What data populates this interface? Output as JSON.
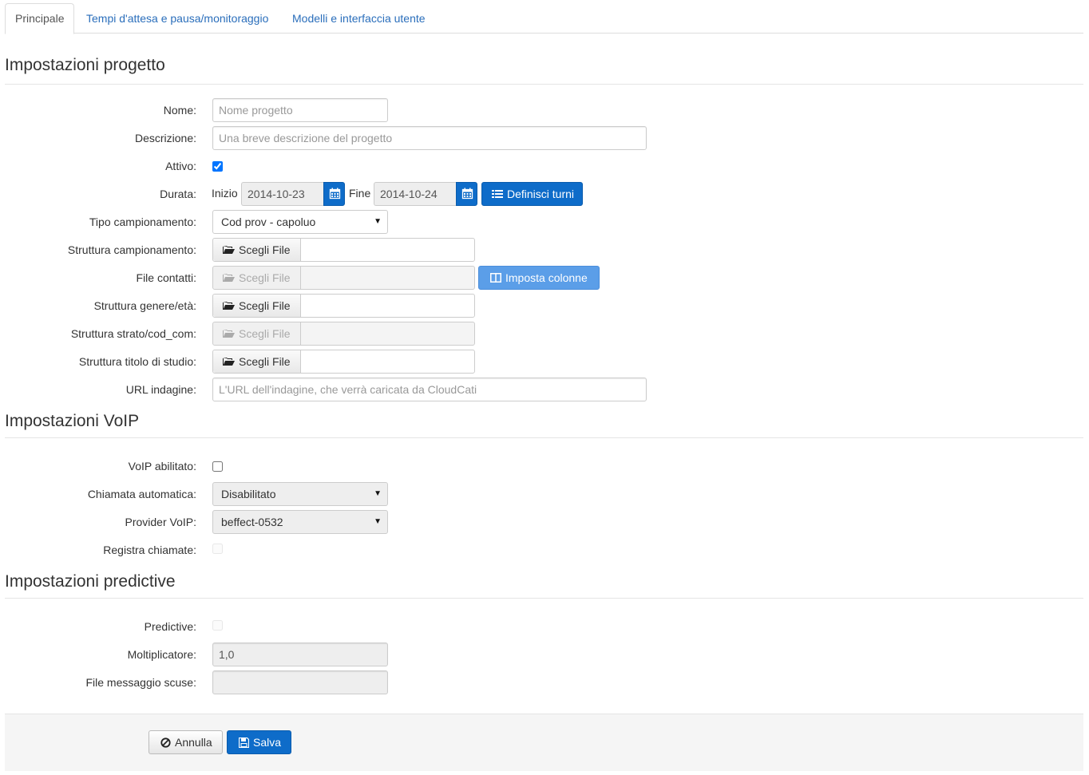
{
  "tabs": [
    {
      "label": "Principale"
    },
    {
      "label": "Tempi d'attesa e pausa/monitoraggio"
    },
    {
      "label": "Modelli e interfaccia utente"
    }
  ],
  "project": {
    "title": "Impostazioni progetto",
    "name_label": "Nome:",
    "name_placeholder": "Nome progetto",
    "desc_label": "Descrizione:",
    "desc_placeholder": "Una breve descrizione del progetto",
    "active_label": "Attivo:",
    "active_checked": true,
    "duration_label": "Durata:",
    "start_label": "Inizio",
    "start_value": "2014-10-23",
    "end_label": "Fine",
    "end_value": "2014-10-24",
    "shifts_button": "Definisci turni",
    "sampling_type_label": "Tipo campionamento:",
    "sampling_type_value": "Cod prov - capoluo",
    "sampling_structure_label": "Struttura campionamento:",
    "contacts_file_label": "File contatti:",
    "columns_button": "Imposta colonne",
    "gender_age_label": "Struttura genere/età:",
    "strata_label": "Struttura strato/cod_com:",
    "education_label": "Struttura titolo di studio:",
    "choose_file": "Scegli File",
    "url_label": "URL indagine:",
    "url_placeholder": "L'URL dell'indagine, che verrà caricata da CloudCati"
  },
  "voip": {
    "title": "Impostazioni VoIP",
    "enabled_label": "VoIP abilitato:",
    "auto_call_label": "Chiamata automatica:",
    "auto_call_value": "Disabilitato",
    "provider_label": "Provider VoIP:",
    "provider_value": "beffect-0532",
    "record_label": "Registra chiamate:"
  },
  "predictive": {
    "title": "Impostazioni predictive",
    "predictive_label": "Predictive:",
    "multiplier_label": "Moltiplicatore:",
    "multiplier_value": "1,0",
    "apology_label": "File messaggio scuse:"
  },
  "footer": {
    "cancel": "Annulla",
    "save": "Salva"
  },
  "colors": {
    "primary": "#0e6cc9",
    "link": "#2a6ebb",
    "light_blue": "#5b9ee8"
  }
}
